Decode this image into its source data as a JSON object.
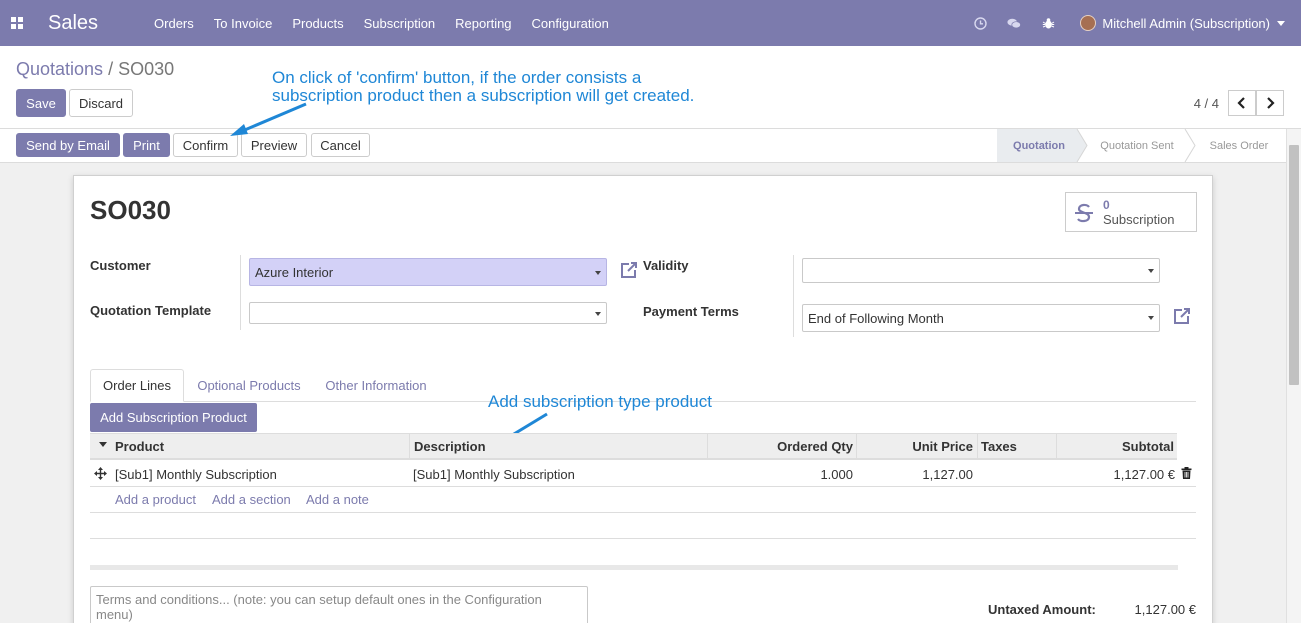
{
  "navbar": {
    "app_name": "Sales",
    "menu": [
      "Orders",
      "To Invoice",
      "Products",
      "Subscription",
      "Reporting",
      "Configuration"
    ],
    "user": "Mitchell Admin (Subscription)",
    "icons": [
      "clock-icon",
      "chat-icon",
      "bug-icon"
    ]
  },
  "breadcrumb": {
    "parent": "Quotations",
    "separator": " / ",
    "current": "SO030"
  },
  "actions": {
    "save": "Save",
    "discard": "Discard"
  },
  "pager": {
    "value": "4 / 4"
  },
  "header_buttons": {
    "send_email": "Send by Email",
    "print": "Print",
    "confirm": "Confirm",
    "preview": "Preview",
    "cancel": "Cancel"
  },
  "statusbar": {
    "stages": [
      "Quotation",
      "Quotation Sent",
      "Sales Order"
    ],
    "active": "Quotation"
  },
  "annotations": {
    "confirm_note_line1": "On click of 'confirm' button, if the order consists a",
    "confirm_note_line2": "subscription product then a subscription will get created.",
    "product_note": "Add subscription type product"
  },
  "form": {
    "name": "SO030",
    "smart_button": {
      "count": "0",
      "label": "Subscription"
    },
    "customer_label": "Customer",
    "customer_value": "Azure Interior",
    "template_label": "Quotation Template",
    "template_value": "",
    "validity_label": "Validity",
    "validity_value": "",
    "payment_terms_label": "Payment Terms",
    "payment_terms_value": "End of Following Month"
  },
  "tabs": [
    "Order Lines",
    "Optional Products",
    "Other Information"
  ],
  "order_lines": {
    "add_button": "Add Subscription Product",
    "columns": {
      "product": "Product",
      "description": "Description",
      "qty": "Ordered Qty",
      "price": "Unit Price",
      "taxes": "Taxes",
      "subtotal": "Subtotal"
    },
    "rows": [
      {
        "product": "[Sub1] Monthly Subscription",
        "description": "[Sub1] Monthly Subscription",
        "qty": "1.000",
        "price": "1,127.00",
        "taxes": "",
        "subtotal": "1,127.00 €"
      }
    ],
    "add_product": "Add a product",
    "add_section": "Add a section",
    "add_note": "Add a note"
  },
  "terms_placeholder": "Terms and conditions... (note: you can setup default ones in the Configuration menu)",
  "totals": {
    "untaxed_label": "Untaxed Amount:",
    "untaxed_value": "1,127.00 €"
  }
}
